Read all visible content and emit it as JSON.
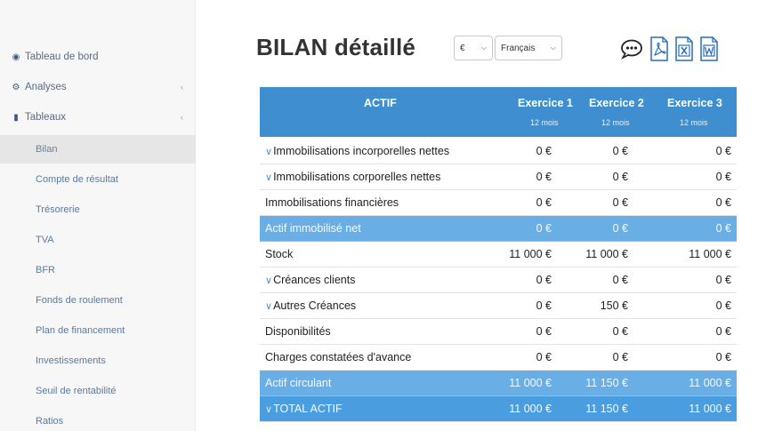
{
  "sidebar": {
    "items": [
      {
        "label": "Tableau de bord",
        "icon": "dashboard-icon"
      },
      {
        "label": "Analyses",
        "icon": "cogs-icon"
      },
      {
        "label": "Tableaux",
        "icon": "bar-chart-icon"
      }
    ],
    "sub_items": [
      {
        "label": "Bilan",
        "active": true
      },
      {
        "label": "Compte de résultat"
      },
      {
        "label": "Trésorerie"
      },
      {
        "label": "TVA"
      },
      {
        "label": "BFR"
      },
      {
        "label": "Fonds de roulement"
      },
      {
        "label": "Plan de financement"
      },
      {
        "label": "Investissements"
      },
      {
        "label": "Seuil de rentabilité"
      },
      {
        "label": "Ratios"
      }
    ]
  },
  "header": {
    "title": "BILAN détaillé",
    "currency_select": "€",
    "language_select": "Français"
  },
  "table": {
    "col_header": "ACTIF",
    "columns": [
      {
        "label": "Exercice 1",
        "sub": "12 mois"
      },
      {
        "label": "Exercice 2",
        "sub": "12 mois"
      },
      {
        "label": "Exercice 3",
        "sub": "12 mois"
      }
    ],
    "rows": [
      {
        "label": "Immobilisations incorporelles nettes",
        "caret": true,
        "values": [
          "0 €",
          "0 €",
          "0 €"
        ]
      },
      {
        "label": "Immobilisations corporelles nettes",
        "caret": true,
        "values": [
          "0 €",
          "0 €",
          "0 €"
        ]
      },
      {
        "label": "Immobilisations financières",
        "values": [
          "0 €",
          "0 €",
          "0 €"
        ]
      },
      {
        "label": "Actif immobilisé net",
        "highlight": true,
        "values": [
          "0 €",
          "0 €",
          "0 €"
        ]
      },
      {
        "label": "Stock",
        "values": [
          "11 000 €",
          "11 000 €",
          "11 000 €"
        ]
      },
      {
        "label": "Créances clients",
        "caret": true,
        "values": [
          "0 €",
          "0 €",
          "0 €"
        ]
      },
      {
        "label": "Autres Créances",
        "caret": true,
        "values": [
          "0 €",
          "150 €",
          "0 €"
        ]
      },
      {
        "label": "Disponibilités",
        "values": [
          "0 €",
          "0 €",
          "0 €"
        ]
      },
      {
        "label": "Charges constatées d'avance",
        "values": [
          "0 €",
          "0 €",
          "0 €"
        ]
      },
      {
        "label": "Actif circulant",
        "highlight": true,
        "values": [
          "11 000 €",
          "11 150 €",
          "11 000 €"
        ]
      },
      {
        "label": "TOTAL ACTIF",
        "total": true,
        "caret": true,
        "values": [
          "11 000 €",
          "11 150 €",
          "11 000 €"
        ]
      }
    ]
  },
  "colors": {
    "header_blue": "#3e8ed0",
    "highlight_blue": "#69afe6",
    "sidebar_bg": "#f7f7f7"
  }
}
